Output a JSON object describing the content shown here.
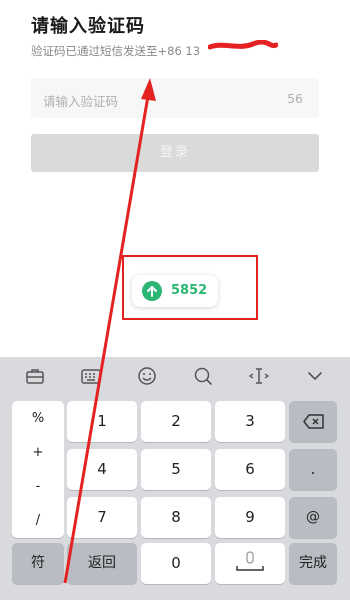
{
  "header": {
    "title": "请输入验证码",
    "subtitle": "验证码已通过短信发送至+86 13"
  },
  "code_field": {
    "placeholder": "请输入验证码",
    "countdown": "56"
  },
  "login_button": {
    "label": "登录"
  },
  "suggestion": {
    "code": "5852",
    "icon": "upload-arrow-icon",
    "color": "#2bb673"
  },
  "annotation": {
    "color": "#e52222"
  },
  "keyboard": {
    "toolbar_icons": [
      "briefcase-icon",
      "keyboard-icon",
      "emoji-icon",
      "search-icon",
      "cursor-icon",
      "chevron-down-icon"
    ],
    "symbols": [
      "%",
      "+",
      "-",
      "/"
    ],
    "digits_row1": [
      "1",
      "2",
      "3"
    ],
    "digits_row2": [
      "4",
      "5",
      "6"
    ],
    "digits_row3": [
      "7",
      "8",
      "9"
    ],
    "dot": ".",
    "at": "@",
    "symbol_key": "符",
    "back_key": "返回",
    "zero": "0",
    "done_key": "完成"
  }
}
